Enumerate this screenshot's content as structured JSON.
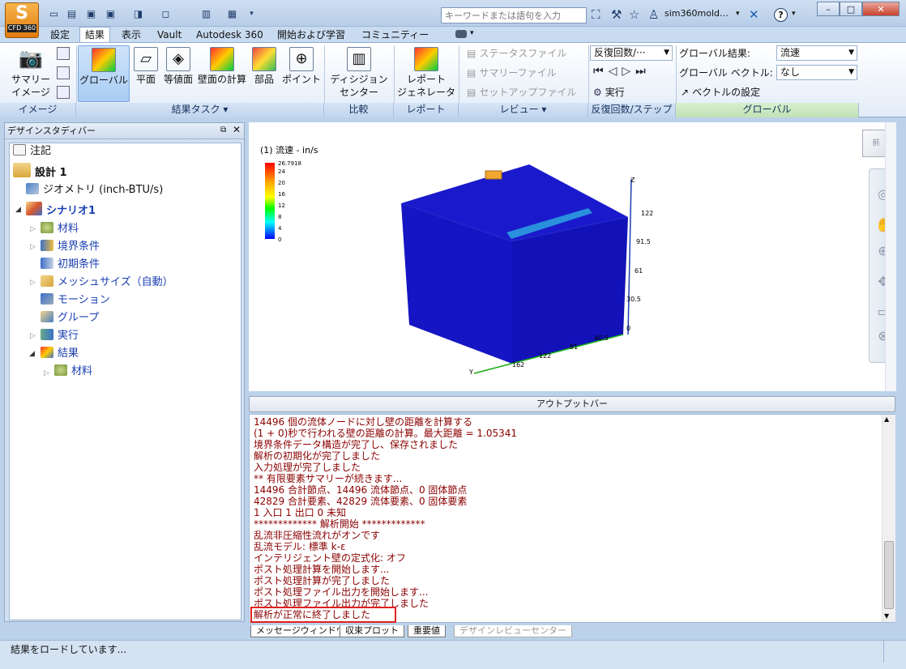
{
  "app": {
    "badge": "CFD 360",
    "search_placeholder": "キーワードまたは語句を入力",
    "user": "sim360mold…",
    "help": "?"
  },
  "tabs": [
    "設定",
    "結果",
    "表示",
    "Vault",
    "Autodesk 360",
    "開始および学習",
    "コミュニティー"
  ],
  "ribbon": {
    "summary": "サマリー\nイメージ",
    "image_panel": "イメージ",
    "global_btn": "グローバル",
    "plane_btn": "平面",
    "isosurface_btn": "等値面",
    "wall_btn": "壁面の計算",
    "parts_btn": "部品",
    "point_btn": "ポイント",
    "result_task_panel": "結果タスク ▾",
    "decision_btn": "ディシジョン\nセンター",
    "compare_panel": "比較",
    "report_btn": "レポート\nジェネレータ",
    "report_panel": "レポート",
    "status_file": "ステータスファイル",
    "summary_file": "サマリーファイル",
    "setup_file": "セットアップファイル",
    "review_panel": "レビュー ▾",
    "iteration_combo": "反復回数/···",
    "run": "実行",
    "iteration_panel": "反復回数/ステップ",
    "global_result_label": "グローバル結果:",
    "global_result_value": "流速",
    "global_vector_label": "グローバル ベクトル:",
    "global_vector_value": "なし",
    "vector_settings": "ベクトルの設定",
    "global_panel": "グローバル"
  },
  "design_study": {
    "title": "デザインスタディバー",
    "items": [
      {
        "label": "注記"
      },
      {
        "label": "設計 1"
      },
      {
        "label": "ジオメトリ (inch-BTU/s)"
      },
      {
        "label": "シナリオ1"
      },
      {
        "label": "材料"
      },
      {
        "label": "境界条件"
      },
      {
        "label": "初期条件"
      },
      {
        "label": "メッシュサイズ（自動）"
      },
      {
        "label": "モーション"
      },
      {
        "label": "グループ"
      },
      {
        "label": "実行"
      },
      {
        "label": "結果"
      },
      {
        "label": "材料"
      }
    ]
  },
  "viewport": {
    "legend_title": "(1) 流速 - in/s",
    "legend_ticks": [
      "26.7918",
      "24",
      "20",
      "16",
      "12",
      "8",
      "4",
      "0"
    ],
    "legend_values": [
      26.7918,
      24,
      20,
      16,
      12,
      8,
      4,
      0
    ],
    "z_ticks": [
      "122",
      "91.5",
      "61",
      "30.5",
      "0"
    ],
    "x_ticks": [
      "40.5",
      "81",
      "122",
      "162"
    ],
    "axis_z": "Z",
    "axis_y": "Y",
    "colors": {
      "body": "#1a1ac8",
      "slot": "#2a8fdc",
      "inlet": "#f0a830"
    },
    "viewcube_label": "前"
  },
  "output": {
    "bar_title": "アウトプットバー",
    "lines": [
      "14496 個の流体ノードに対し壁の距離を計算する",
      "(1 + 0)秒で行われる壁の距離の計算。最大距離 = 1.05341",
      "境界条件データ構造が完了し、保存されました",
      "解析の初期化が完了しました",
      "入力処理が完了しました",
      "** 有限要素サマリーが続きます...",
      "14496 合計節点、14496 流体節点、0 固体節点",
      "42829 合計要素、42829 流体要素、0 固体要素",
      "1 入口  1 出口 0 未知",
      "************* 解析開始 *************",
      "乱流非圧縮性流れがオンです",
      "乱流モデル: 標準 k-ε",
      "インテリジェント壁の定式化: オフ",
      "ポスト処理計算を開始します...",
      "ポスト処理計算が完了しました",
      "ポスト処理ファイル出力を開始します...",
      "ポスト処理ファイル出力が完了しました",
      "解析が正常に終了しました"
    ],
    "tabs": [
      "メッセージウィンドウ",
      "収束プロット",
      "重要値",
      "デザインレビューセンター"
    ]
  },
  "status": {
    "text": "結果をロードしています..."
  }
}
